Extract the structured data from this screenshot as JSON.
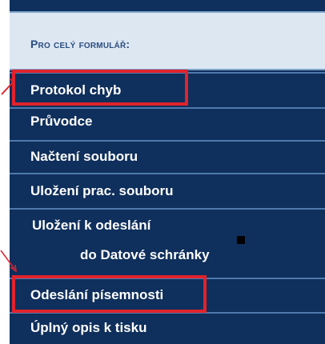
{
  "header": {
    "title": "Pro celý formulář:"
  },
  "menu": {
    "items": [
      {
        "label": "Protokol chyb"
      },
      {
        "label": "Průvodce"
      },
      {
        "label": "Načtení souboru"
      },
      {
        "label": "Uložení prac. souboru"
      },
      {
        "label": "Uložení k odeslání",
        "label2": "do Datové schránky"
      },
      {
        "label": "Odeslání písemnosti"
      },
      {
        "label": "Úplný opis k tisku"
      }
    ]
  },
  "colors": {
    "panel": "#0f2f5c",
    "header_bg": "#dde7f2",
    "highlight": "#e1232c"
  }
}
